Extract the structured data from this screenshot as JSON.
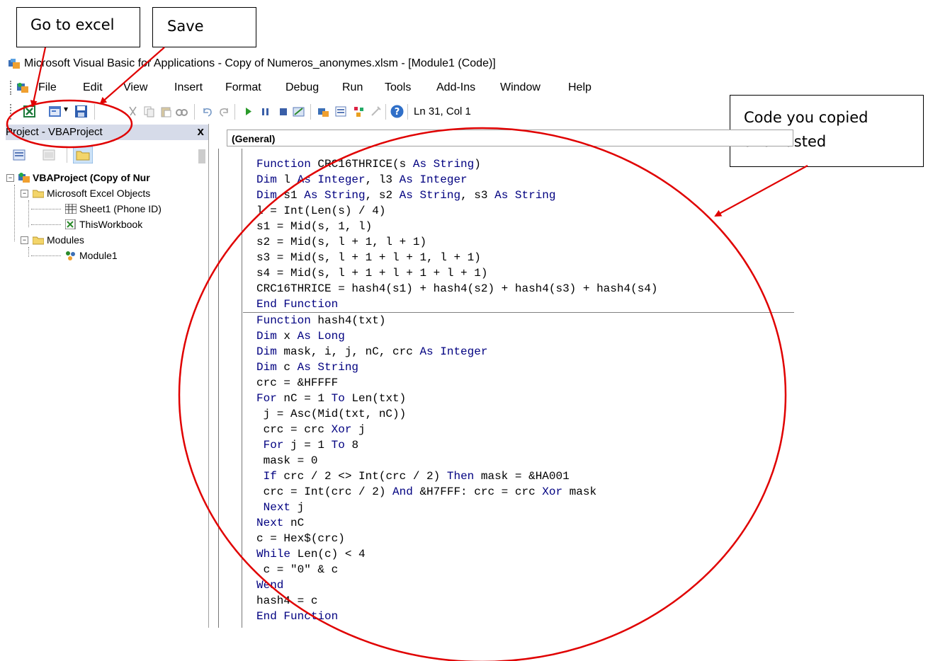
{
  "callouts": {
    "go_to_excel": "Go to excel",
    "save": "Save",
    "code_copied_line1": "Code you copied",
    "code_copied_line2": "and Pasted"
  },
  "window": {
    "title": "Microsoft Visual Basic for Applications - Copy of Numeros_anonymes.xlsm - [Module1 (Code)]"
  },
  "menu": [
    "File",
    "Edit",
    "View",
    "Insert",
    "Format",
    "Debug",
    "Run",
    "Tools",
    "Add-Ins",
    "Window",
    "Help"
  ],
  "toolbar": {
    "cursor_position": "Ln 31, Col 1",
    "icons": [
      "excel-icon",
      "insert-userform-icon",
      "save-icon",
      "cut-icon",
      "copy-icon",
      "paste-icon",
      "find-icon",
      "undo-icon",
      "redo-icon",
      "run-icon",
      "break-icon",
      "reset-icon",
      "design-mode-icon",
      "project-explorer-icon",
      "properties-icon",
      "object-browser-icon",
      "toolbox-icon",
      "help-icon"
    ]
  },
  "project_panel": {
    "title": "Project - VBAProject",
    "close": "x",
    "tree": {
      "root": "VBAProject (Copy of Nur",
      "excel_objects": "Microsoft Excel Objects",
      "sheet1": "Sheet1 (Phone ID)",
      "thisworkbook": "ThisWorkbook",
      "modules": "Modules",
      "module1": "Module1"
    }
  },
  "code_window": {
    "object_dropdown": "(General)",
    "procedures": [
      [
        [
          {
            "k": true,
            "t": "Function "
          },
          {
            "k": false,
            "t": "CRC16THRICE(s "
          },
          {
            "k": true,
            "t": "As String"
          },
          {
            "k": false,
            "t": ")"
          }
        ],
        [
          {
            "k": true,
            "t": "Dim "
          },
          {
            "k": false,
            "t": "l "
          },
          {
            "k": true,
            "t": "As Integer"
          },
          {
            "k": false,
            "t": ", l3 "
          },
          {
            "k": true,
            "t": "As Integer"
          }
        ],
        [
          {
            "k": true,
            "t": "Dim "
          },
          {
            "k": false,
            "t": "s1 "
          },
          {
            "k": true,
            "t": "As String"
          },
          {
            "k": false,
            "t": ", s2 "
          },
          {
            "k": true,
            "t": "As String"
          },
          {
            "k": false,
            "t": ", s3 "
          },
          {
            "k": true,
            "t": "As String"
          }
        ],
        [
          {
            "k": false,
            "t": "l = Int(Len(s) / 4)"
          }
        ],
        [
          {
            "k": false,
            "t": "s1 = Mid(s, 1, l)"
          }
        ],
        [
          {
            "k": false,
            "t": "s2 = Mid(s, l + 1, l + 1)"
          }
        ],
        [
          {
            "k": false,
            "t": "s3 = Mid(s, l + 1 + l + 1, l + 1)"
          }
        ],
        [
          {
            "k": false,
            "t": "s4 = Mid(s, l + 1 + l + 1 + l + 1)"
          }
        ],
        [
          {
            "k": false,
            "t": "CRC16THRICE = hash4(s1) + hash4(s2) + hash4(s3) + hash4(s4)"
          }
        ],
        [
          {
            "k": true,
            "t": "End Function"
          }
        ]
      ],
      [
        [
          {
            "k": true,
            "t": "Function "
          },
          {
            "k": false,
            "t": "hash4(txt)"
          }
        ],
        [
          {
            "k": true,
            "t": "Dim "
          },
          {
            "k": false,
            "t": "x "
          },
          {
            "k": true,
            "t": "As Long"
          }
        ],
        [
          {
            "k": true,
            "t": "Dim "
          },
          {
            "k": false,
            "t": "mask, i, j, nC, crc "
          },
          {
            "k": true,
            "t": "As Integer"
          }
        ],
        [
          {
            "k": true,
            "t": "Dim "
          },
          {
            "k": false,
            "t": "c "
          },
          {
            "k": true,
            "t": "As String"
          }
        ],
        [
          {
            "k": false,
            "t": "crc = &HFFFF"
          }
        ],
        [
          {
            "k": true,
            "t": "For "
          },
          {
            "k": false,
            "t": "nC = 1 "
          },
          {
            "k": true,
            "t": "To "
          },
          {
            "k": false,
            "t": "Len(txt)"
          }
        ],
        [
          {
            "k": false,
            "t": " j = Asc(Mid(txt, nC))"
          }
        ],
        [
          {
            "k": false,
            "t": " crc = crc "
          },
          {
            "k": true,
            "t": "Xor "
          },
          {
            "k": false,
            "t": "j"
          }
        ],
        [
          {
            "k": false,
            "t": " "
          },
          {
            "k": true,
            "t": "For "
          },
          {
            "k": false,
            "t": "j = 1 "
          },
          {
            "k": true,
            "t": "To "
          },
          {
            "k": false,
            "t": "8"
          }
        ],
        [
          {
            "k": false,
            "t": " mask = 0"
          }
        ],
        [
          {
            "k": false,
            "t": " "
          },
          {
            "k": true,
            "t": "If "
          },
          {
            "k": false,
            "t": "crc / 2 <> Int(crc / 2) "
          },
          {
            "k": true,
            "t": "Then "
          },
          {
            "k": false,
            "t": "mask = &HA001"
          }
        ],
        [
          {
            "k": false,
            "t": " crc = Int(crc / 2) "
          },
          {
            "k": true,
            "t": "And "
          },
          {
            "k": false,
            "t": "&H7FFF: crc = crc "
          },
          {
            "k": true,
            "t": "Xor "
          },
          {
            "k": false,
            "t": "mask"
          }
        ],
        [
          {
            "k": false,
            "t": " "
          },
          {
            "k": true,
            "t": "Next "
          },
          {
            "k": false,
            "t": "j"
          }
        ],
        [
          {
            "k": true,
            "t": "Next "
          },
          {
            "k": false,
            "t": "nC"
          }
        ],
        [
          {
            "k": false,
            "t": "c = Hex$(crc)"
          }
        ],
        [
          {
            "k": true,
            "t": "While "
          },
          {
            "k": false,
            "t": "Len(c) < 4"
          }
        ],
        [
          {
            "k": false,
            "t": " c = \"0\" & c"
          }
        ],
        [
          {
            "k": true,
            "t": "Wend"
          }
        ],
        [
          {
            "k": false,
            "t": "hash4 = c"
          }
        ],
        [
          {
            "k": true,
            "t": "End Function"
          }
        ]
      ]
    ]
  },
  "colors": {
    "keyword": "#000080",
    "annotation": "#e00000",
    "panel_header": "#d6dbe9"
  }
}
